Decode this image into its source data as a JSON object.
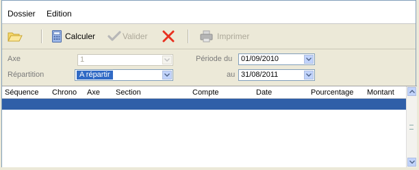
{
  "menu": {
    "items": [
      "Dossier",
      "Edition"
    ]
  },
  "toolbar": {
    "open_icon": "folder-open-icon",
    "calc_label": "Calculer",
    "validate_label": "Valider",
    "print_label": "Imprimer"
  },
  "form": {
    "axe_label": "Axe",
    "axe_value": "1",
    "repartition_label": "Répartition",
    "repartition_value": "A répartir",
    "periode_label": "Période du",
    "periode_from": "01/09/2010",
    "au_label": "au",
    "periode_to": "31/08/2011"
  },
  "grid": {
    "columns": [
      "Séquence",
      "Chrono",
      "Axe",
      "Section",
      "Compte",
      "Date",
      "Pourcentage",
      "Montant"
    ]
  },
  "colors": {
    "selection": "#316ac5",
    "row_selected": "#2f5fa8",
    "disabled_text": "#aca899"
  }
}
